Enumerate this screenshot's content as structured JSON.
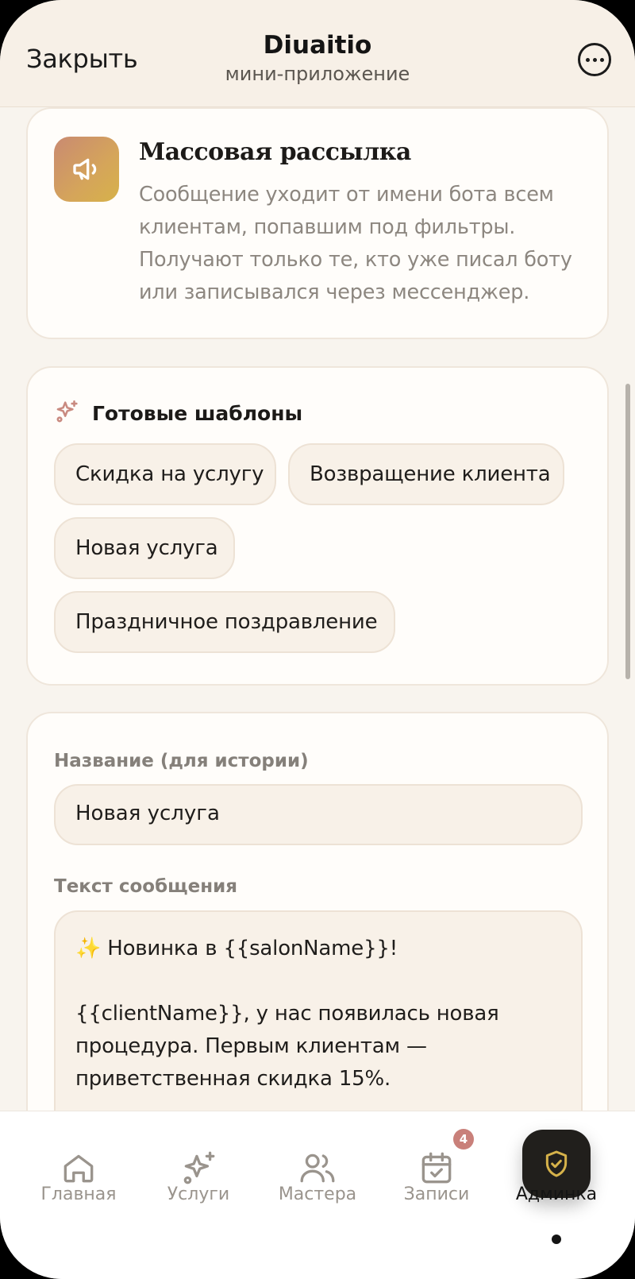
{
  "header": {
    "close_label": "Закрыть",
    "app_title": "Diuaitio",
    "app_subtitle": "мини-приложение",
    "more_icon": "more-horizontal-icon"
  },
  "info_card": {
    "icon": "megaphone-icon",
    "title": "Массовая рассылка",
    "description": "Сообщение уходит от имени бота всем клиентам, попавшим под фильтры. Получают только те, кто уже писал боту или записывался через мессенджер."
  },
  "templates": {
    "icon": "sparkles-icon",
    "heading": "Готовые шаблоны",
    "chips": [
      "Скидка на услугу",
      "Возвращение клиента",
      "Новая услуга",
      "Праздничное поздравление"
    ]
  },
  "form": {
    "name_label": "Название (для истории)",
    "name_value": "Новая услуга",
    "message_label": "Текст сообщения",
    "message_value": "✨ Новинка в {{salonName}}!\n\n{{clientName}}, у нас появилась новая процедура. Первым клиентам — приветственная скидка 15%."
  },
  "bottom_nav": {
    "items": [
      {
        "label": "Главная",
        "icon": "home-icon"
      },
      {
        "label": "Услуги",
        "icon": "sparkles-icon"
      },
      {
        "label": "Мастера",
        "icon": "users-icon"
      },
      {
        "label": "Записи",
        "icon": "calendar-check-icon",
        "badge": "4"
      },
      {
        "label": "Админка",
        "icon": "shield-check-icon",
        "active": true
      }
    ]
  },
  "colors": {
    "background": "#f8f4ee",
    "accent_gold": "#d5a55a",
    "badge": "#c9807a",
    "active_pill": "#211f1c"
  }
}
